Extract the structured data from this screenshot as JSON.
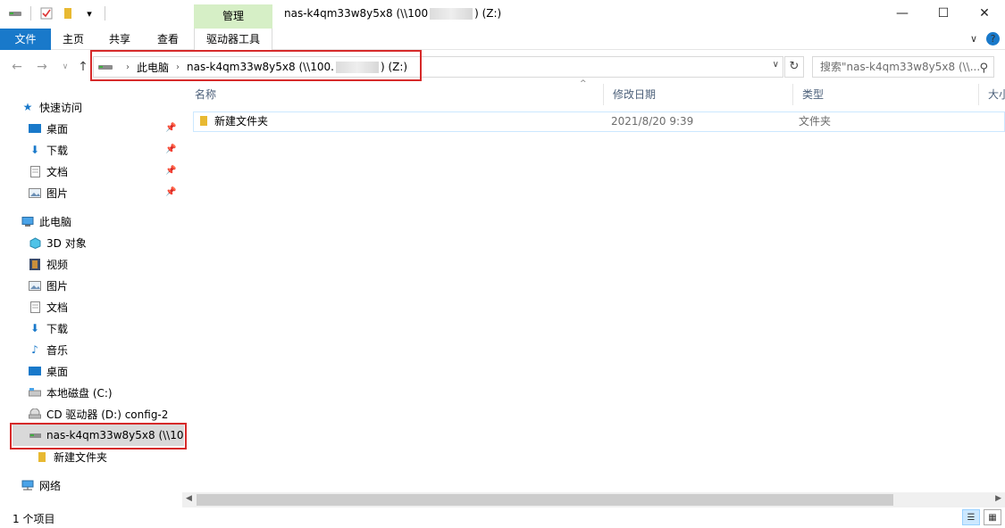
{
  "window": {
    "title_prefix": "nas-k4qm33w8y5x8 (\\\\100",
    "title_suffix": ") (Z:)",
    "minimize": "—",
    "maximize": "☐",
    "close": "✕"
  },
  "ribbon": {
    "manage_label": "管理",
    "tabs": [
      "文件",
      "主页",
      "共享",
      "查看",
      "驱动器工具"
    ],
    "expand": "∨",
    "help": "?"
  },
  "address": {
    "crumbs": [
      "此电脑",
      "nas-k4qm33w8y5x8 (\\\\100.",
      ") (Z:)"
    ],
    "search_placeholder": "搜索\"nas-k4qm33w8y5x8 (\\\\..."
  },
  "sidebar": {
    "quick_access": "快速访问",
    "quick_items": [
      "桌面",
      "下载",
      "文档",
      "图片"
    ],
    "this_pc": "此电脑",
    "pc_items": [
      "3D 对象",
      "视频",
      "图片",
      "文档",
      "下载",
      "音乐",
      "桌面",
      "本地磁盘 (C:)",
      "CD 驱动器 (D:) config-2",
      "nas-k4qm33w8y5x8 (\\\\10"
    ],
    "sub_folder": "新建文件夹",
    "network": "网络"
  },
  "columns": [
    "名称",
    "修改日期",
    "类型",
    "大小"
  ],
  "files": [
    {
      "name": "新建文件夹",
      "modified": "2021/8/20 9:39",
      "type": "文件夹"
    }
  ],
  "status": {
    "count": "1 个项目"
  },
  "colors": {
    "accent": "#1979ca",
    "manage_band": "#d6efc6",
    "highlight_border": "#d62a2a",
    "folder": "#e8b932"
  }
}
